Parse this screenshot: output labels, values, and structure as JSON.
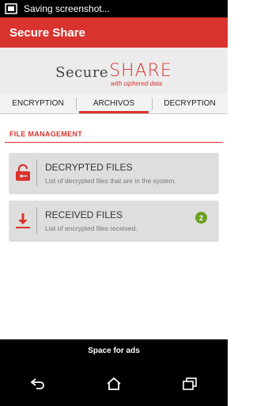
{
  "status_bar": {
    "notification_text": "Saving screenshot..."
  },
  "app_bar": {
    "title": "Secure Share"
  },
  "banner": {
    "logo_word": "Secure",
    "logo_accent": "SHARE",
    "logo_tagline": "with ciphered data"
  },
  "tabs": [
    {
      "label": "ENCRYPTION",
      "active": false
    },
    {
      "label": "ARCHIVOS",
      "active": true
    },
    {
      "label": "DECRYPTION",
      "active": false
    }
  ],
  "section": {
    "title": "FILE MANAGEMENT"
  },
  "cards": [
    {
      "title": "DECRYPTED FILES",
      "subtitle": "List of decrypted files that are in the system.",
      "icon": "unlocked-padlock-icon"
    },
    {
      "title": "RECEIVED FILES",
      "subtitle": "List of encrypted files received.",
      "icon": "download-arrow-icon",
      "badge": "2"
    }
  ],
  "ad_bar": {
    "text": "Space for ads"
  },
  "colors": {
    "brand_red": "#d9332f",
    "badge_green": "#6aa120"
  }
}
